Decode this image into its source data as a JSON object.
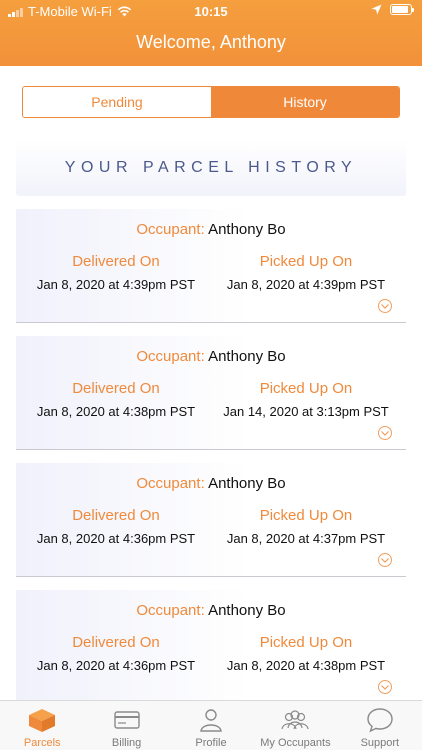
{
  "status_bar": {
    "carrier": "T-Mobile Wi-Fi",
    "time": "10:15"
  },
  "header": {
    "title": "Welcome, Anthony"
  },
  "segment": {
    "pending": "Pending",
    "history": "History",
    "selected": "History"
  },
  "section_title": "YOUR PARCEL HISTORY",
  "labels": {
    "occupant": "Occupant:",
    "delivered": "Delivered On",
    "picked_up": "Picked Up On"
  },
  "parcels": [
    {
      "occupant": "Anthony Bo",
      "delivered_on": "Jan 8, 2020 at 4:39pm PST",
      "picked_up_on": "Jan 8, 2020 at 4:39pm PST"
    },
    {
      "occupant": "Anthony Bo",
      "delivered_on": "Jan 8, 2020 at 4:38pm PST",
      "picked_up_on": "Jan 14, 2020 at 3:13pm PST"
    },
    {
      "occupant": "Anthony Bo",
      "delivered_on": "Jan 8, 2020 at 4:36pm PST",
      "picked_up_on": "Jan 8, 2020 at 4:37pm PST"
    },
    {
      "occupant": "Anthony Bo",
      "delivered_on": "Jan 8, 2020 at 4:36pm PST",
      "picked_up_on": "Jan 8, 2020 at 4:38pm PST"
    }
  ],
  "tabs": [
    {
      "label": "Parcels",
      "icon": "parcel-box-icon",
      "active": true
    },
    {
      "label": "Billing",
      "icon": "billing-card-icon",
      "active": false
    },
    {
      "label": "Profile",
      "icon": "profile-person-icon",
      "active": false
    },
    {
      "label": "My Occupants",
      "icon": "occupants-group-icon",
      "active": false
    },
    {
      "label": "Support",
      "icon": "support-chat-icon",
      "active": false
    }
  ],
  "colors": {
    "brand_orange": "#f0883a",
    "section_title": "#4a5a8c"
  }
}
